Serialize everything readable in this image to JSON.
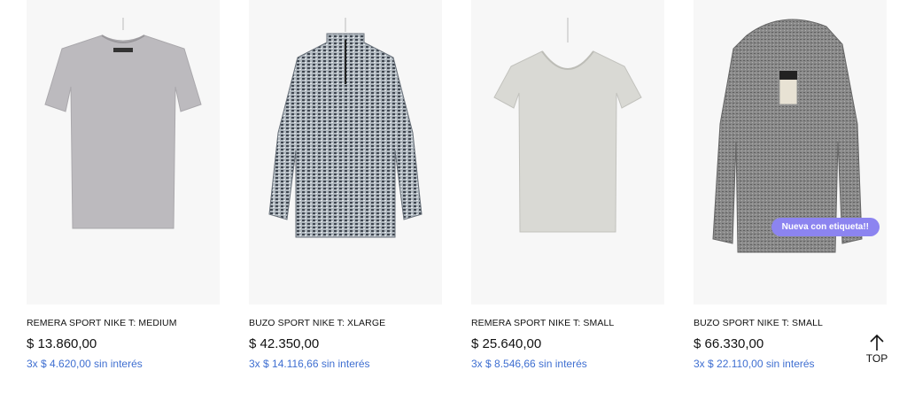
{
  "products": [
    {
      "title": "REMERA SPORT NIKE T: MEDIUM",
      "price": "$ 13.860,00",
      "installments": "3x $ 4.620,00 sin interés",
      "image": "grey-tshirt-crew-neck"
    },
    {
      "title": "BUZO SPORT NIKE T: XLARGE",
      "price": "$ 42.350,00",
      "installments": "3x $ 14.116,66 sin interés",
      "image": "heather-half-zip-pullover"
    },
    {
      "title": "REMERA SPORT NIKE T: SMALL",
      "price": "$ 25.640,00",
      "installments": "3x $ 8.546,66 sin interés",
      "image": "light-grey-tshirt-v-neck"
    },
    {
      "title": "BUZO SPORT NIKE T: SMALL",
      "price": "$ 66.330,00",
      "installments": "3x $ 22.110,00 sin interés",
      "badge": "Nueva con etiqueta!!",
      "image": "grey-hoodie-with-tag"
    }
  ],
  "back_to_top": {
    "label": "TOP",
    "icon": "arrow-up-icon"
  },
  "colors": {
    "installments": "#3f6fd1",
    "badge": "#8c84f0"
  }
}
